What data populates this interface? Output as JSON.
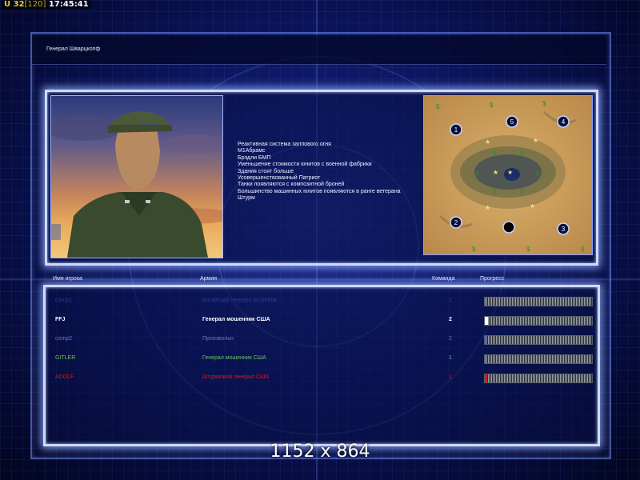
{
  "hud": {
    "unit_label": "U",
    "unit_count": "32",
    "unit_cap": "[120]",
    "clock": "17:45:41"
  },
  "general": {
    "name": "Генерал Шварцкопф"
  },
  "bonuses": [
    "Реактивная система залпового огня",
    "М1Абрамс",
    "Брэдли БМП",
    "Уменьшение стоимости юнитов с военной фабрики",
    "Здания стоят больше",
    "Усовершенствованный Патриот",
    "Танки появляются с композитной броней",
    "Большинство машинных юнитов появляются в ранге ветерана",
    "Штурм"
  ],
  "map": {
    "start_positions": [
      "1",
      "2",
      "3",
      "4",
      "5",
      ""
    ],
    "colors": {
      "sand": "#c89a58",
      "lake": "#1e2c66",
      "marker": "#0a0f3a"
    }
  },
  "table": {
    "headers": {
      "name": "Имя игрока",
      "army": "Армия",
      "team": "Команда",
      "progress": "Прогресс"
    },
    "rows": [
      {
        "name": "comp1",
        "army": "Китайский генерал ястребов",
        "team": "1",
        "color": "#343c8c",
        "progress": 0.0,
        "fill": "#3a4aa0"
      },
      {
        "name": "FFJ",
        "army": "Генерал мошенник США",
        "team": "2",
        "color": "#ffffff",
        "progress": 0.03,
        "fill": "#ffffff"
      },
      {
        "name": "comp2",
        "army": "Произвольн",
        "team": "2",
        "color": "#6a78c8",
        "progress": 0.02,
        "fill": "#5a64c0"
      },
      {
        "name": "GITLER",
        "army": "Генерал мошенник США",
        "team": "1",
        "color": "#6ec060",
        "progress": 0.0,
        "fill": "#5ab050"
      },
      {
        "name": "ADOLF",
        "army": "Штурмовой генерал США",
        "team": "1",
        "color": "#e01818",
        "progress": 0.02,
        "fill": "#e01818"
      }
    ]
  },
  "resolution": "1152 x 864"
}
